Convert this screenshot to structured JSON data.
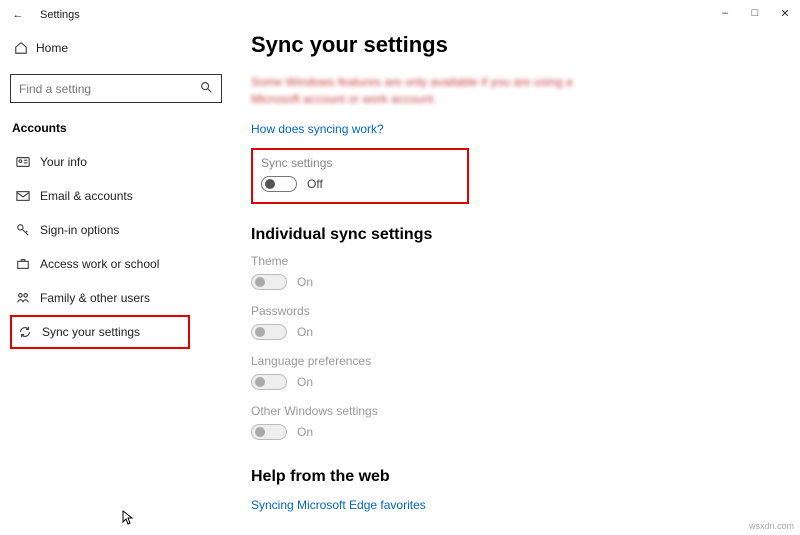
{
  "titlebar": {
    "title": "Settings"
  },
  "sidebar": {
    "home": "Home",
    "search_placeholder": "Find a setting",
    "section": "Accounts",
    "items": [
      {
        "label": "Your info"
      },
      {
        "label": "Email & accounts"
      },
      {
        "label": "Sign-in options"
      },
      {
        "label": "Access work or school"
      },
      {
        "label": "Family & other users"
      },
      {
        "label": "Sync your settings"
      }
    ]
  },
  "page": {
    "title": "Sync your settings",
    "notice": "Some Windows features are only available if you are using a Microsoft account or work account.",
    "how_link": "How does syncing work?",
    "sync_main": {
      "label": "Sync settings",
      "state": "Off"
    },
    "individual_heading": "Individual sync settings",
    "individual": [
      {
        "label": "Theme",
        "state": "On"
      },
      {
        "label": "Passwords",
        "state": "On"
      },
      {
        "label": "Language preferences",
        "state": "On"
      },
      {
        "label": "Other Windows settings",
        "state": "On"
      }
    ],
    "help_heading": "Help from the web",
    "help_link": "Syncing Microsoft Edge favorites"
  },
  "watermark": "wsxdn.com"
}
